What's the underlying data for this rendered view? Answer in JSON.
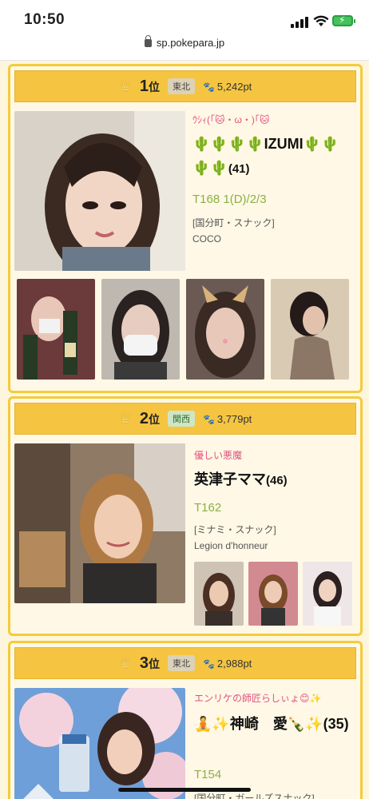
{
  "status": {
    "time": "10:50"
  },
  "browser": {
    "url": "sp.pokepara.jp"
  },
  "rankings": [
    {
      "rank": "1",
      "rank_suffix": "位",
      "region": "東北",
      "points": "5,242pt",
      "catch": "ｳｼｨ(｢🐱・ω・)｢🐱",
      "name": "🌵🌵🌵🌵IZUMI🌵🌵🌵🌵",
      "age": "(41)",
      "spec": "T168 1(D)/2/3",
      "shop_area": "[国分町・スナック]",
      "shop_name": "COCO"
    },
    {
      "rank": "2",
      "rank_suffix": "位",
      "region": "関西",
      "points": "3,779pt",
      "catch": "優しい悪魔",
      "name": "英津子ママ",
      "age": "(46)",
      "spec": "T162",
      "shop_area": "[ミナミ・スナック]",
      "shop_name": "Legion d'honneur"
    },
    {
      "rank": "3",
      "rank_suffix": "位",
      "region": "東北",
      "points": "2,988pt",
      "catch": "エンリケの師匠らしぃょ😊✨",
      "name": "🧘✨神崎　愛🍾✨(35)",
      "age": "",
      "spec": "T154",
      "shop_area": "[国分町・ガールズスナック]",
      "shop_name": ""
    }
  ],
  "icons": {
    "crown": "crown-icon",
    "paw": "paw-icon",
    "lock": "lock-icon"
  },
  "colors": {
    "header_gold": "#f5c542",
    "card_bg": "#fff8e6",
    "catch_pink": "#e0527f",
    "spec_green": "#8ab145"
  }
}
